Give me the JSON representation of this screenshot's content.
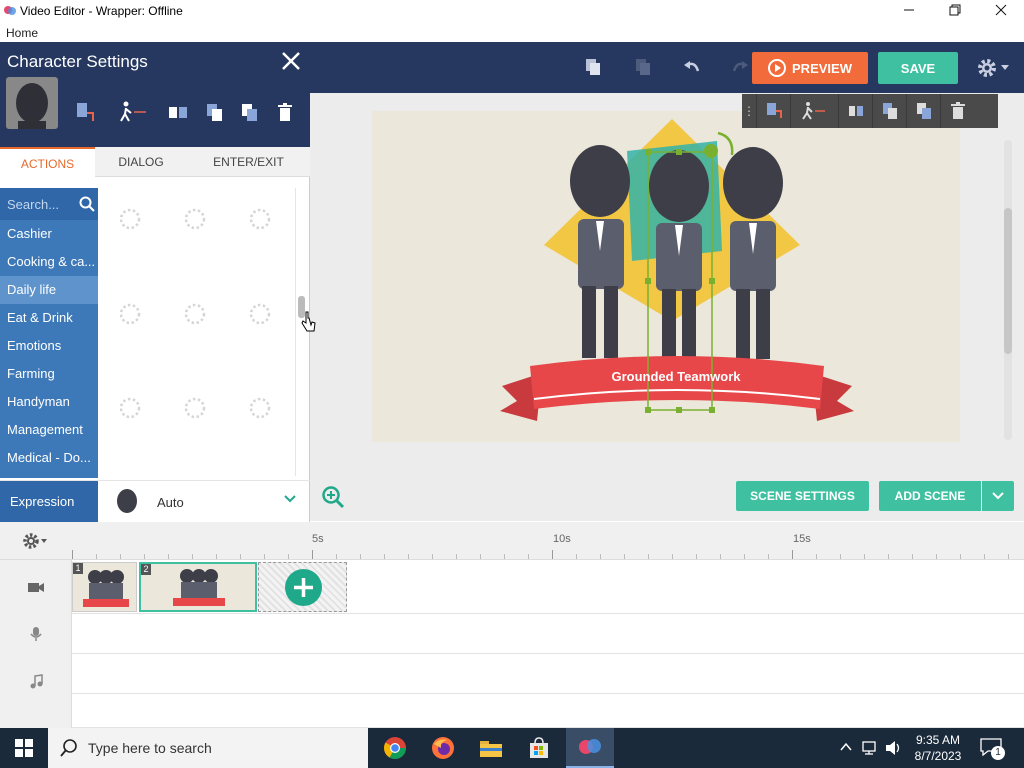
{
  "window": {
    "title": "Video Editor - Wrapper: Offline",
    "menu_home": "Home"
  },
  "toolbar": {
    "preview_label": "PREVIEW",
    "save_label": "SAVE"
  },
  "panel": {
    "title": "Character Settings",
    "tabs": [
      "ACTIONS",
      "DIALOG",
      "ENTER/EXIT"
    ],
    "active_tab": "ACTIONS",
    "search_placeholder": "Search...",
    "categories": [
      "Cashier",
      "Cooking & ca...",
      "Daily life",
      "Eat & Drink",
      "Emotions",
      "Farming",
      "Handyman",
      "Management",
      "Medical - Do..."
    ],
    "selected_category": "Daily life",
    "expression_label": "Expression",
    "expression_value": "Auto"
  },
  "stage": {
    "banner_text": "Grounded Teamwork"
  },
  "scene_buttons": {
    "scene_settings": "SCENE SETTINGS",
    "add_scene": "ADD SCENE"
  },
  "timeline": {
    "ruler_labels": [
      "5s",
      "10s",
      "15s"
    ],
    "scenes": [
      "1",
      "2"
    ]
  },
  "taskbar": {
    "search_placeholder": "Type here to search",
    "time": "9:35 AM",
    "date": "8/7/2023",
    "notification_count": "1"
  },
  "colors": {
    "nav_dark": "#263860",
    "accent_orange": "#f26b3a",
    "accent_teal": "#3fc0a0",
    "category_blue": "#3d78b8"
  }
}
